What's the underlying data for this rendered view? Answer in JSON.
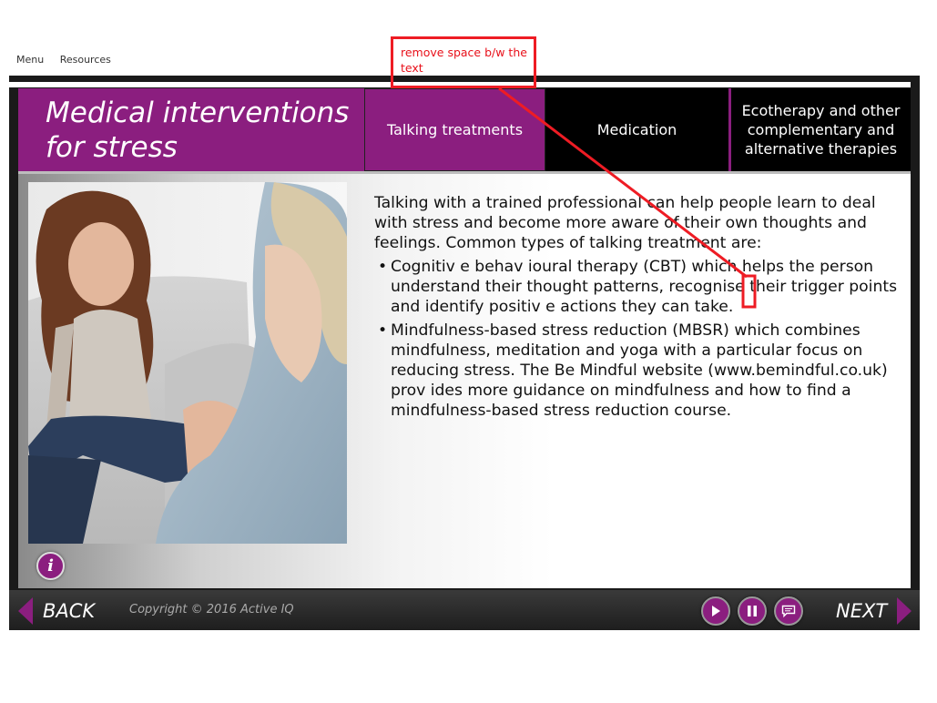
{
  "top_menu": {
    "menu_label": "Menu",
    "resources_label": "Resources"
  },
  "header": {
    "title_line1": "Medical interventions",
    "title_line2": "for stress",
    "tabs": [
      {
        "label": "Talking treatments",
        "active": true
      },
      {
        "label": "Medication",
        "active": false
      },
      {
        "label_line1": "Ecotherapy and other",
        "label_line2": "complementary and",
        "label_line3": "alternative therapies",
        "active": false
      }
    ]
  },
  "content": {
    "intro": "Talking with a trained professional can help people learn to deal with stress and become more aware of their own thoughts and feelings. Common types of talking treatment are:",
    "bullets": [
      "Cognitiv e behav ioural therapy (CBT) which helps the person understand their thought patterns, recognise their trigger points and identify positiv e actions they can take.",
      "Mindfulness-based stress reduction (MBSR) which combines mindfulness, meditation and yoga with a particular focus on reducing stress. The Be Mindful website (www.bemindful.co.uk) prov ides more guidance on mindfulness and how to find a mindfulness-based stress reduction course."
    ],
    "photo_alt": "Woman talking with a therapist"
  },
  "info_button": {
    "label": "i",
    "icon": "info-icon"
  },
  "footer": {
    "back_label": "BACK",
    "copyright": "Copyright © 2016 Active IQ",
    "next_label": "NEXT",
    "controls": [
      "play-icon",
      "pause-icon",
      "transcript-icon"
    ]
  },
  "annotation": {
    "text": "remove space b/w the text",
    "color": "#ee1c24"
  },
  "colors": {
    "accent": "#8b1e7f",
    "frame": "#1a1a1a",
    "annotation": "#ee1c24"
  }
}
